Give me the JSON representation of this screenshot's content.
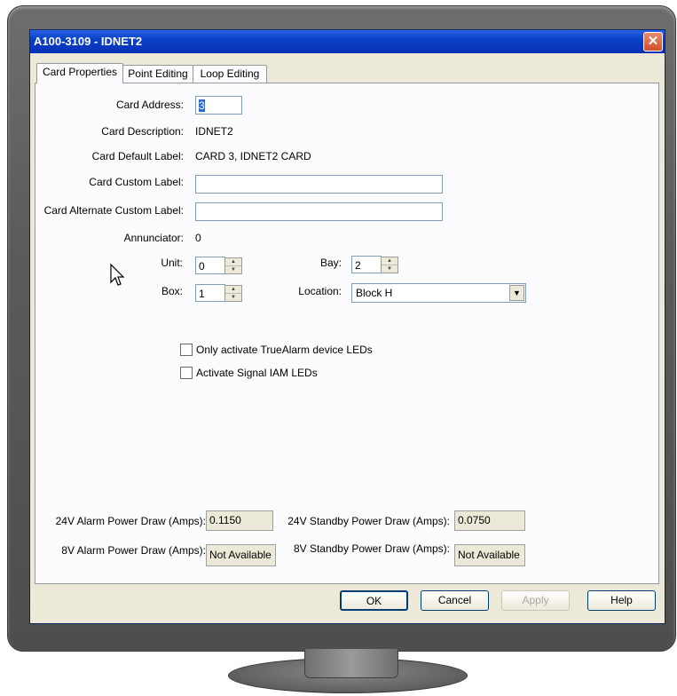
{
  "window": {
    "title": "A100-3109 - IDNET2",
    "close_glyph": "✕"
  },
  "tabs": [
    {
      "label": "Card Properties",
      "active": true
    },
    {
      "label": "Point Editing",
      "active": false
    },
    {
      "label": "Loop Editing",
      "active": false
    }
  ],
  "card": {
    "address_label": "Card Address:",
    "address_value": "3",
    "description_label": "Card Description:",
    "description_value": "IDNET2",
    "default_label_label": "Card Default Label:",
    "default_label_value": "CARD 3, IDNET2 CARD",
    "custom_label_label": "Card Custom Label:",
    "custom_label_value": "",
    "alt_custom_label_label": "Card Alternate Custom Label:",
    "alt_custom_label_value": "",
    "annunciator_label": "Annunciator:",
    "annunciator_value": "0"
  },
  "location": {
    "unit_label": "Unit:",
    "unit_value": "0",
    "box_label": "Box:",
    "box_value": "1",
    "bay_label": "Bay:",
    "bay_value": "2",
    "location_label": "Location:",
    "location_value": "Block H"
  },
  "options": {
    "truealarm_label": "Only activate TrueAlarm device LEDs",
    "truealarm_checked": false,
    "signal_iam_label": "Activate Signal IAM LEDs",
    "signal_iam_checked": false
  },
  "power": {
    "alarm24_label": "24V Alarm Power Draw (Amps):",
    "alarm24_value": "0.1150",
    "standby24_label": "24V Standby Power Draw (Amps):",
    "standby24_value": "0.0750",
    "alarm8_label": "8V Alarm Power Draw (Amps):",
    "alarm8_value": "Not Available",
    "standby8_label": "8V Standby Power Draw (Amps):",
    "standby8_value": "Not Available"
  },
  "buttons": {
    "ok": "OK",
    "cancel": "Cancel",
    "apply": "Apply",
    "help": "Help"
  },
  "icons": {
    "close": "close-icon",
    "spin_up": "spin-up-icon",
    "spin_down": "spin-down-icon",
    "dropdown": "chevron-down-icon",
    "cursor": "mouse-pointer-icon"
  },
  "colors": {
    "titlebar": "#0a3fc8",
    "dialog_bg": "#ece9d8",
    "close_button": "#d2502c",
    "monitor": "#5a5a5a"
  }
}
